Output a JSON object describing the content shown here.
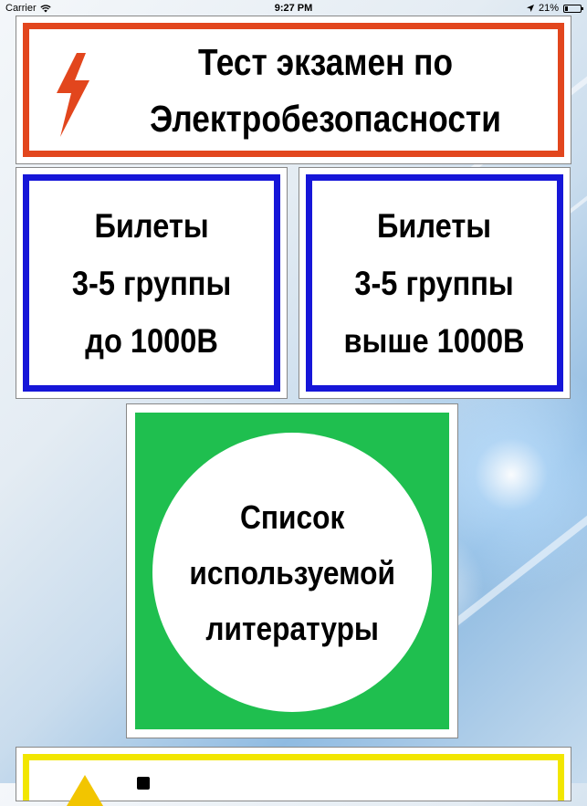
{
  "status_bar": {
    "carrier": "Carrier",
    "time": "9:27 PM",
    "battery": "21%",
    "battery_level": 0.21
  },
  "title_card": {
    "line1": "Тест экзамен по",
    "line2": "Электробезопасности",
    "icon": "lightning-bolt-icon",
    "border_color": "#e2461d"
  },
  "tickets_low": {
    "line1": "Билеты",
    "line2": "3-5 группы",
    "line3": "до 1000В",
    "border_color": "#1616d8"
  },
  "tickets_high": {
    "line1": "Билеты",
    "line2": "3-5 группы",
    "line3": "выше 1000В",
    "border_color": "#1616d8"
  },
  "literature": {
    "line1": "Список",
    "line2": "используемой",
    "line3": "литературы",
    "background_color": "#1fbf4f"
  },
  "partial_card": {
    "border_color": "#f2e600",
    "icon": "warning-icon"
  }
}
